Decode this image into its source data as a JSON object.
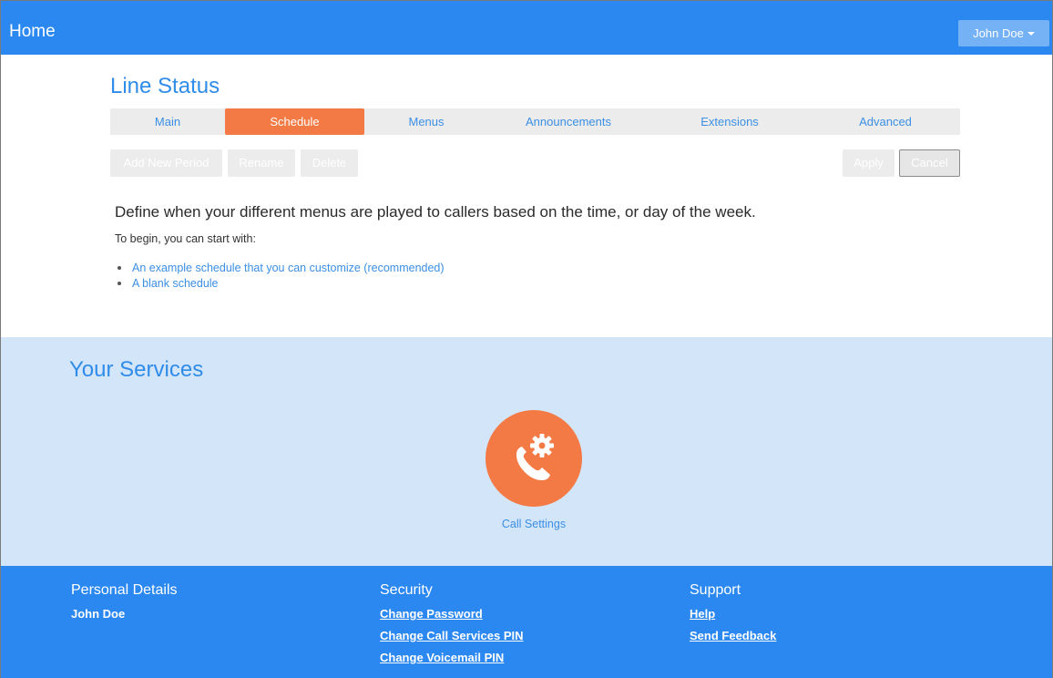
{
  "header": {
    "home_label": "Home",
    "user_menu_label": "John Doe"
  },
  "main": {
    "title": "Line Status",
    "tabs": [
      {
        "label": "Main",
        "active": false
      },
      {
        "label": "Schedule",
        "active": true
      },
      {
        "label": "Menus",
        "active": false
      },
      {
        "label": "Announcements",
        "active": false
      },
      {
        "label": "Extensions",
        "active": false
      },
      {
        "label": "Advanced",
        "active": false
      }
    ],
    "toolbar": {
      "add_new_period": "Add New Period",
      "rename": "Rename",
      "delete": "Delete",
      "apply": "Apply",
      "cancel": "Cancel"
    },
    "intro": "Define when your different menus are played to callers based on the time, or day of the week.",
    "begin_text": "To begin, you can start with:",
    "options": [
      "An example schedule that you can customize (recommended)",
      "A blank schedule"
    ]
  },
  "services": {
    "title": "Your Services",
    "items": [
      {
        "label": "Call Settings",
        "icon": "phone-gear-icon"
      }
    ]
  },
  "footer": {
    "personal": {
      "title": "Personal Details",
      "name": "John Doe"
    },
    "security": {
      "title": "Security",
      "links": [
        "Change Password",
        "Change Call Services PIN",
        "Change Voicemail PIN"
      ]
    },
    "support": {
      "title": "Support",
      "links": [
        "Help",
        "Send Feedback"
      ]
    }
  },
  "colors": {
    "brand_blue": "#2b88f0",
    "accent_orange": "#f47a45",
    "services_bg": "#d3e5f9",
    "link_blue": "#3b8fe5"
  }
}
